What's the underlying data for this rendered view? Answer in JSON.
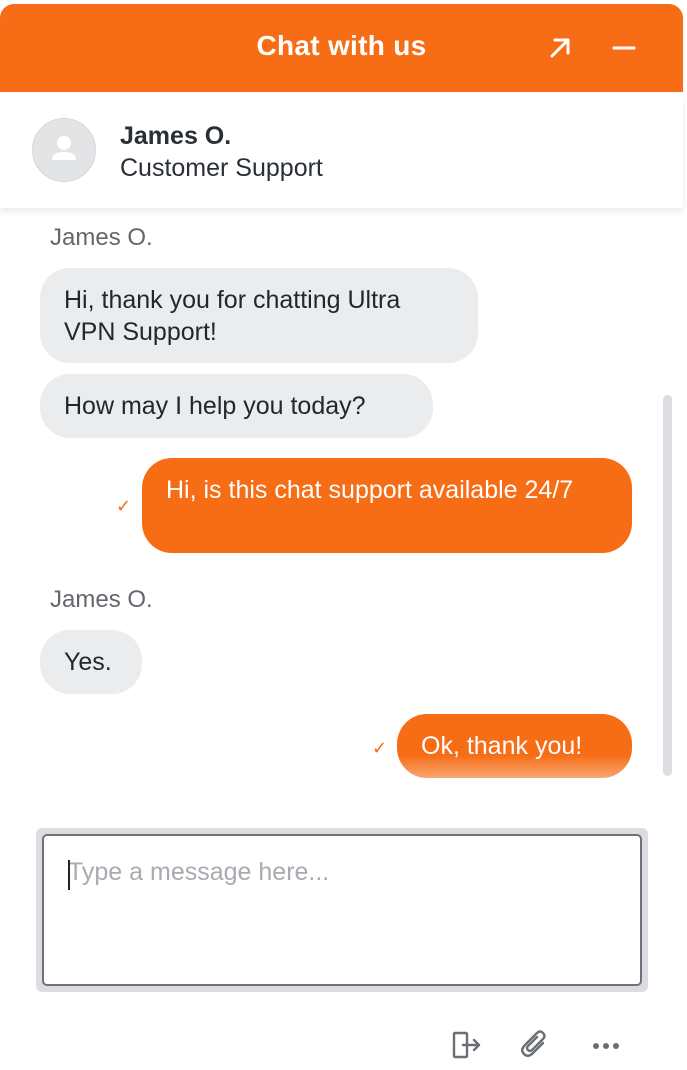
{
  "header": {
    "title": "Chat with us",
    "expand_icon": "arrow-up-right-icon",
    "minimize_icon": "minus-icon",
    "accent_color": "#f66d16"
  },
  "agent": {
    "avatar_icon": "user-silhouette-icon",
    "name": "James O.",
    "role": "Customer Support"
  },
  "messages": [
    {
      "sender_label": "James O."
    },
    {
      "direction": "in",
      "text": "Hi, thank you for chatting Ultra VPN Support!"
    },
    {
      "direction": "in",
      "text": "How may I help you today?"
    },
    {
      "direction": "out",
      "text": "Hi, is this chat support available 24/7",
      "status_icon": "checkmark-icon"
    },
    {
      "sender_label": "James O."
    },
    {
      "direction": "in",
      "text": "Yes."
    },
    {
      "direction": "out",
      "text": "Ok, thank you!",
      "status_icon": "checkmark-icon"
    }
  ],
  "composer": {
    "placeholder": "Type a message here..."
  },
  "footer": {
    "icons": [
      "exit-icon",
      "paperclip-icon",
      "more-options-icon"
    ]
  }
}
